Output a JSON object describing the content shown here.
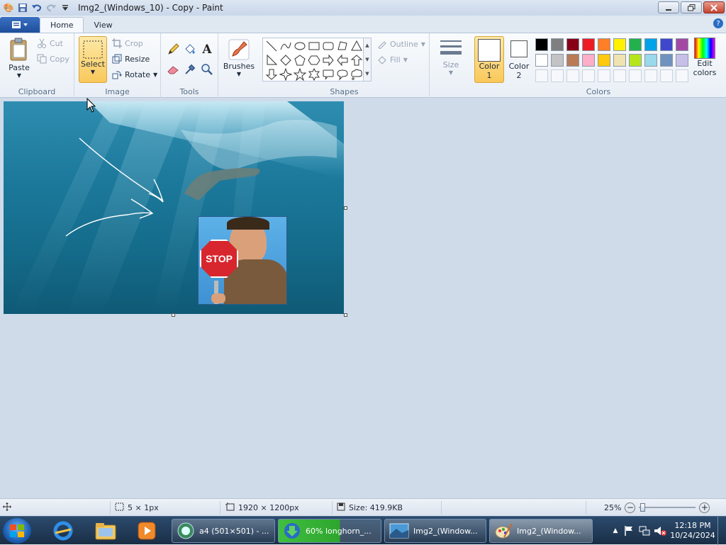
{
  "window": {
    "title": "Img2_(Windows_10) - Copy - Paint"
  },
  "tabs": {
    "home": "Home",
    "view": "View"
  },
  "help": "?",
  "clipboard": {
    "label": "Clipboard",
    "paste": "Paste",
    "cut": "Cut",
    "copy": "Copy"
  },
  "image": {
    "label": "Image",
    "select": "Select",
    "crop": "Crop",
    "resize": "Resize",
    "rotate": "Rotate"
  },
  "tools": {
    "label": "Tools",
    "text_glyph": "A"
  },
  "brushes": {
    "label": "Brushes"
  },
  "shapes": {
    "label": "Shapes",
    "outline": "Outline",
    "fill": "Fill"
  },
  "size": {
    "label": "Size"
  },
  "colors": {
    "label": "Colors",
    "color1_line1": "Color",
    "color1_line2": "1",
    "color2_line1": "Color",
    "color2_line2": "2",
    "edit_line1": "Edit",
    "edit_line2": "colors",
    "row1": [
      "#000000",
      "#7f7f7f",
      "#880015",
      "#ed1c24",
      "#ff7f27",
      "#fff200",
      "#22b14c",
      "#00a2e8",
      "#3f48cc",
      "#a349a4"
    ],
    "row2": [
      "#ffffff",
      "#c3c3c3",
      "#b97a57",
      "#ffaec9",
      "#ffc90e",
      "#efe4b0",
      "#b5e61d",
      "#99d9ea",
      "#7092be",
      "#c8bfe7"
    ]
  },
  "sticker": {
    "sign_text": "STOP"
  },
  "status": {
    "selection": "5 × 1px",
    "dimensions": "1920 × 1200px",
    "size": "Size: 419.9KB",
    "zoom": "25%"
  },
  "taskbar": {
    "items": [
      {
        "label": "a4 (501×501) - ..."
      },
      {
        "label": "60% longhorn_..."
      },
      {
        "label": "Img2_(Window..."
      },
      {
        "label": "Img2_(Window..."
      }
    ],
    "time": "12:18 PM",
    "date": "10/24/2024"
  }
}
